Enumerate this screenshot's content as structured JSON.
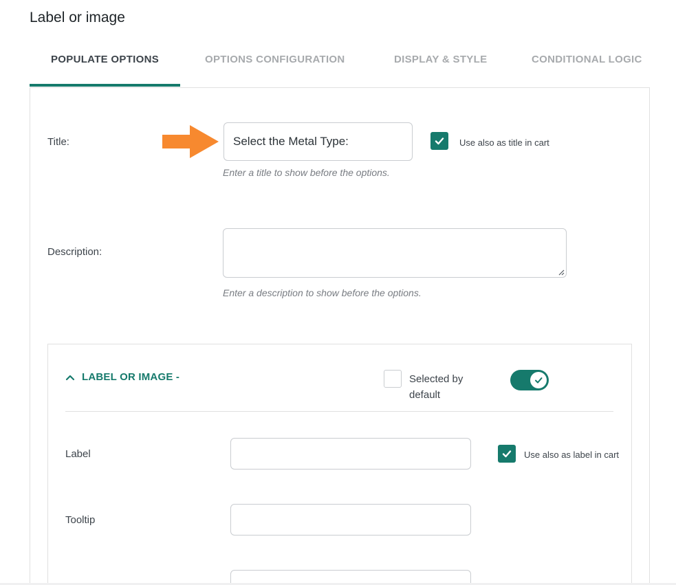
{
  "page": {
    "title": "Label or image"
  },
  "tabs": [
    {
      "label": "POPULATE OPTIONS",
      "active": true
    },
    {
      "label": "OPTIONS CONFIGURATION",
      "active": false
    },
    {
      "label": "DISPLAY & STYLE",
      "active": false
    },
    {
      "label": "CONDITIONAL LOGIC",
      "active": false
    }
  ],
  "title_field": {
    "label": "Title:",
    "value": "Select the Metal Type:",
    "hint": "Enter a title to show before the options.",
    "checkbox_label": "Use also as title in cart",
    "checkbox_checked": true
  },
  "description_field": {
    "label": "Description:",
    "value": "",
    "hint": "Enter a description to show before the options."
  },
  "option_section": {
    "title": "LABEL OR IMAGE -",
    "selected_default_label": "Selected by default",
    "selected_default_checked": false,
    "enabled": true,
    "label_field": {
      "label": "Label",
      "value": "",
      "checkbox_label": "Use also as label in cart",
      "checkbox_checked": true
    },
    "tooltip_field": {
      "label": "Tooltip",
      "value": ""
    },
    "third_field": {
      "value": ""
    }
  },
  "colors": {
    "accent": "#167a6c",
    "arrow": "#f7892f",
    "muted_tab": "#a7aaad"
  }
}
